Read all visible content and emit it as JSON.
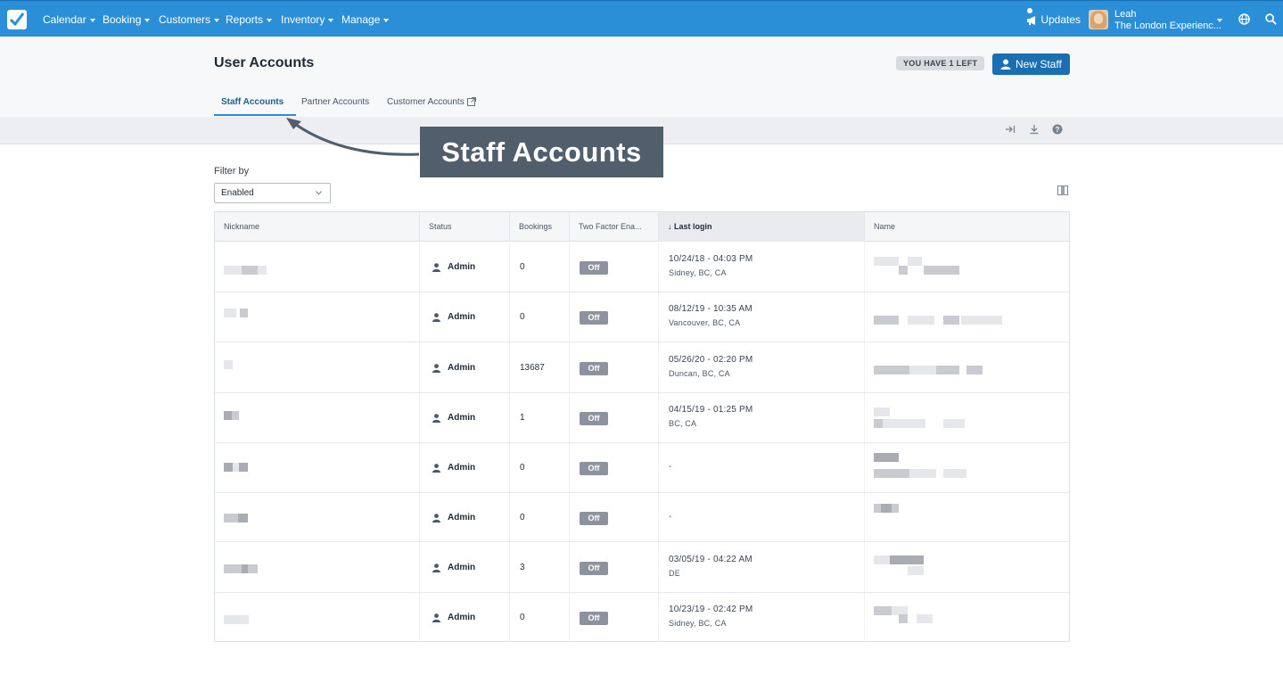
{
  "nav": {
    "items": [
      {
        "label": "Calendar"
      },
      {
        "label": "Booking"
      },
      {
        "label": "Customers"
      },
      {
        "label": "Reports"
      },
      {
        "label": "Inventory"
      },
      {
        "label": "Manage"
      }
    ],
    "updates_label": "Updates",
    "user_name": "Leah",
    "user_company": "The London Experienc..."
  },
  "page": {
    "title": "User Accounts",
    "quota_badge": "YOU HAVE 1 LEFT",
    "new_staff_label": "New Staff"
  },
  "tabs": [
    {
      "label": "Staff Accounts",
      "active": true
    },
    {
      "label": "Partner Accounts",
      "active": false
    },
    {
      "label": "Customer Accounts",
      "active": false
    }
  ],
  "callout": {
    "text": "Staff Accounts"
  },
  "filter": {
    "label": "Filter by",
    "value": "Enabled"
  },
  "table": {
    "columns": [
      "Nickname",
      "Status",
      "Bookings",
      "Two Factor Ena...",
      "Last login",
      "Name"
    ],
    "sorted_column": "Last login",
    "rows": [
      {
        "status": "Admin",
        "bookings": "0",
        "two_factor": "Off",
        "login_date": "10/24/18 - 04:03 PM",
        "login_location": "Sidney, BC, CA"
      },
      {
        "status": "Admin",
        "bookings": "0",
        "two_factor": "Off",
        "login_date": "08/12/19 - 10:35 AM",
        "login_location": "Vancouver, BC, CA"
      },
      {
        "status": "Admin",
        "bookings": "13687",
        "two_factor": "Off",
        "login_date": "05/26/20 - 02:20 PM",
        "login_location": "Duncan, BC, CA"
      },
      {
        "status": "Admin",
        "bookings": "1",
        "two_factor": "Off",
        "login_date": "04/15/19 - 01:25 PM",
        "login_location": "BC, CA"
      },
      {
        "status": "Admin",
        "bookings": "0",
        "two_factor": "Off",
        "login_date": "-",
        "login_location": ""
      },
      {
        "status": "Admin",
        "bookings": "0",
        "two_factor": "Off",
        "login_date": "-",
        "login_location": ""
      },
      {
        "status": "Admin",
        "bookings": "3",
        "two_factor": "Off",
        "login_date": "03/05/19 - 04:22 AM",
        "login_location": "DE"
      },
      {
        "status": "Admin",
        "bookings": "0",
        "two_factor": "Off",
        "login_date": "10/23/19 - 02:42 PM",
        "login_location": "Sidney, BC, CA"
      }
    ]
  },
  "colors": {
    "nav_bg": "#2b8fd8",
    "primary_button": "#1a6fb3",
    "badge_off": "#8c939c",
    "callout_bg": "#515e6c"
  }
}
